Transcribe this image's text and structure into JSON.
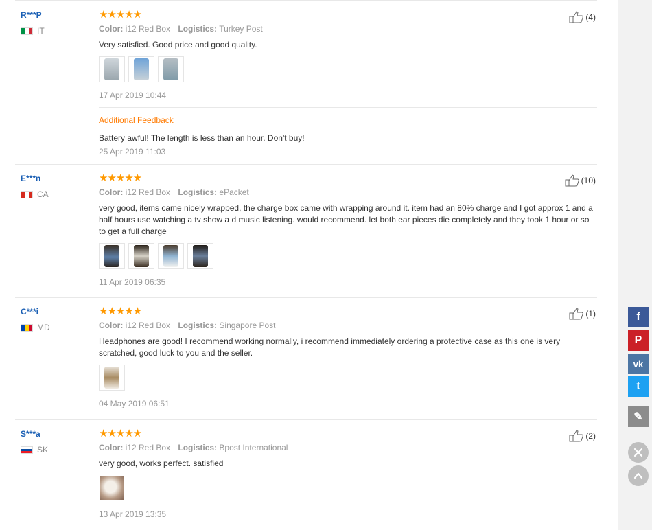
{
  "reviews": [
    {
      "user": "R***P",
      "country": "IT",
      "flag": [
        "#009246",
        "#ffffff",
        "#ce2b37"
      ],
      "stars": "★★★★★",
      "color_label": "Color:",
      "color_value": "i12 Red Box",
      "logistics_label": "Logistics:",
      "logistics_value": "Turkey Post",
      "text": "Very satisfied. Good price and good quality.",
      "photo_count": 3,
      "date": "17 Apr 2019 10:44",
      "helpful": "(4)",
      "additional": {
        "heading": "Additional Feedback",
        "text": "Battery awful! The length is less than an hour. Don't buy!",
        "date": "25 Apr 2019 11:03"
      }
    },
    {
      "user": "E***n",
      "country": "CA",
      "flag": [
        "#d52b1e",
        "#ffffff",
        "#d52b1e"
      ],
      "stars": "★★★★★",
      "color_label": "Color:",
      "color_value": "i12 Red Box",
      "logistics_label": "Logistics:",
      "logistics_value": "ePacket",
      "text": "very good, items came nicely wrapped, the charge box came with wrapping around it. item had an 80% charge and I got approx 1 and a half hours use watching a tv show a d music listening. would recommend. let both ear pieces die completely and they took 1 hour or so to get a full charge",
      "photo_count": 4,
      "date": "11 Apr 2019 06:35",
      "helpful": "(10)"
    },
    {
      "user": "C***i",
      "country": "MD",
      "flag": [
        "#0046ae",
        "#ffd200",
        "#cc092f"
      ],
      "stars": "★★★★★",
      "color_label": "Color:",
      "color_value": "i12 Red Box",
      "logistics_label": "Logistics:",
      "logistics_value": "Singapore Post",
      "text": "Headphones are good! I recommend working normally, i recommend immediately ordering a protective case as this one is very scratched, good luck to you and the seller.",
      "photo_count": 1,
      "date": "04 May 2019 06:51",
      "helpful": "(1)"
    },
    {
      "user": "S***a",
      "country": "SK",
      "flag": [
        "#ffffff",
        "#0b4ea2",
        "#ee1c25"
      ],
      "stars": "★★★★★",
      "color_label": "Color:",
      "color_value": "i12 Red Box",
      "logistics_label": "Logistics:",
      "logistics_value": "Bpost International",
      "text": "very good, works perfect. satisfied",
      "photo_count": 1,
      "date": "13 Apr 2019 13:35",
      "helpful": "(2)"
    }
  ],
  "share_bar": [
    {
      "name": "facebook-icon",
      "glyph": "f",
      "color": "#3b5998"
    },
    {
      "name": "pinterest-icon",
      "glyph": "P",
      "color": "#cb2027"
    },
    {
      "name": "vk-icon",
      "glyph": "vk",
      "color": "#4c75a3"
    },
    {
      "name": "twitter-icon",
      "glyph": "t",
      "color": "#1da1f2"
    },
    {
      "name": "edit-icon",
      "glyph": "✎",
      "color": "#8c8c8c"
    }
  ],
  "colors": {
    "username": "#1a5fb4",
    "star": "#ff9900",
    "additional_heading": "#ff7a00",
    "muted": "#999999"
  }
}
